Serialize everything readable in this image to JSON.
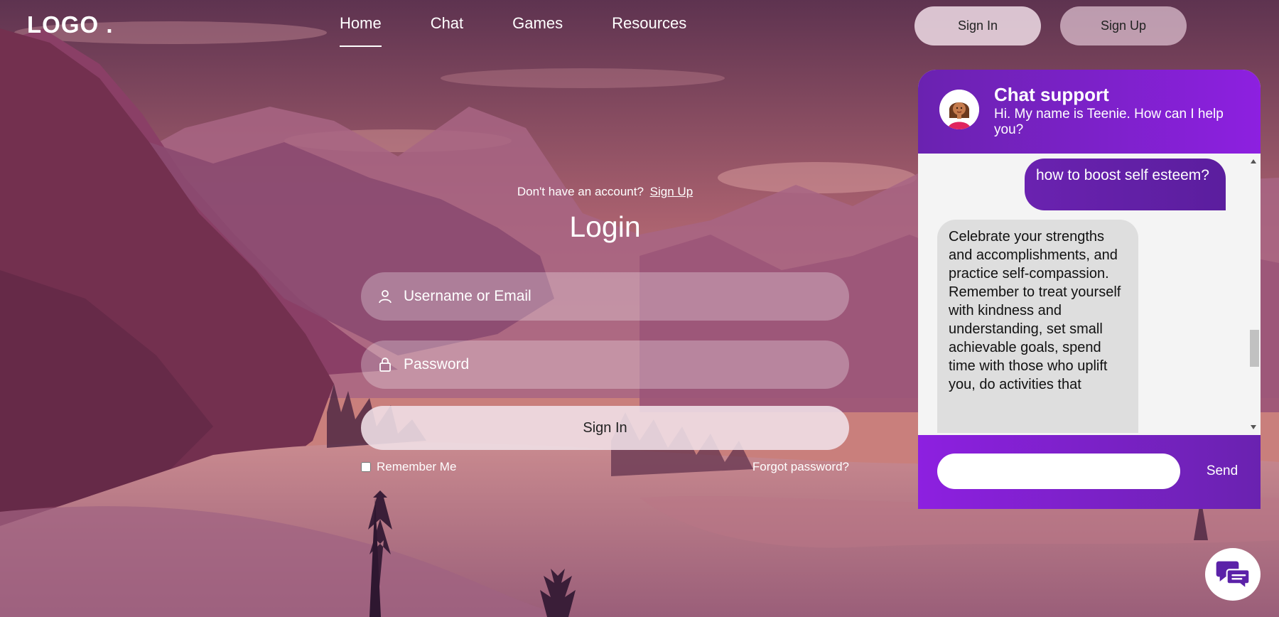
{
  "header": {
    "logo": "LOGO .",
    "nav": [
      "Home",
      "Chat",
      "Games",
      "Resources"
    ],
    "active_nav": "Home",
    "sign_in_label": "Sign In",
    "sign_up_label": "Sign Up"
  },
  "login": {
    "no_account_text": "Don't have an account?",
    "sign_up_link": "Sign Up",
    "title": "Login",
    "username_placeholder": "Username or Email",
    "password_placeholder": "Password",
    "submit_label": "Sign In",
    "remember_label": "Remember Me",
    "forgot_label": "Forgot password?"
  },
  "chat": {
    "title": "Chat support",
    "subtitle": "Hi. My name is Teenie. How can I help you?",
    "messages": [
      {
        "from": "user",
        "text": "how to boost self esteem?"
      },
      {
        "from": "bot",
        "text": "Celebrate your strengths and accomplishments, and practice self-compassion. Remember to treat yourself with kindness and understanding, set small achievable goals, spend time with those who uplift you, do activities that"
      }
    ],
    "input_value": "",
    "send_label": "Send"
  },
  "icons": {
    "user": "user-icon",
    "lock": "lock-icon",
    "avatar": "avatar-teenie",
    "launcher": "chat-bubbles-icon"
  },
  "colors": {
    "chat_purple_dark": "#6a22b0",
    "chat_purple_light": "#8d20e0",
    "background": "#7a3f5e"
  }
}
